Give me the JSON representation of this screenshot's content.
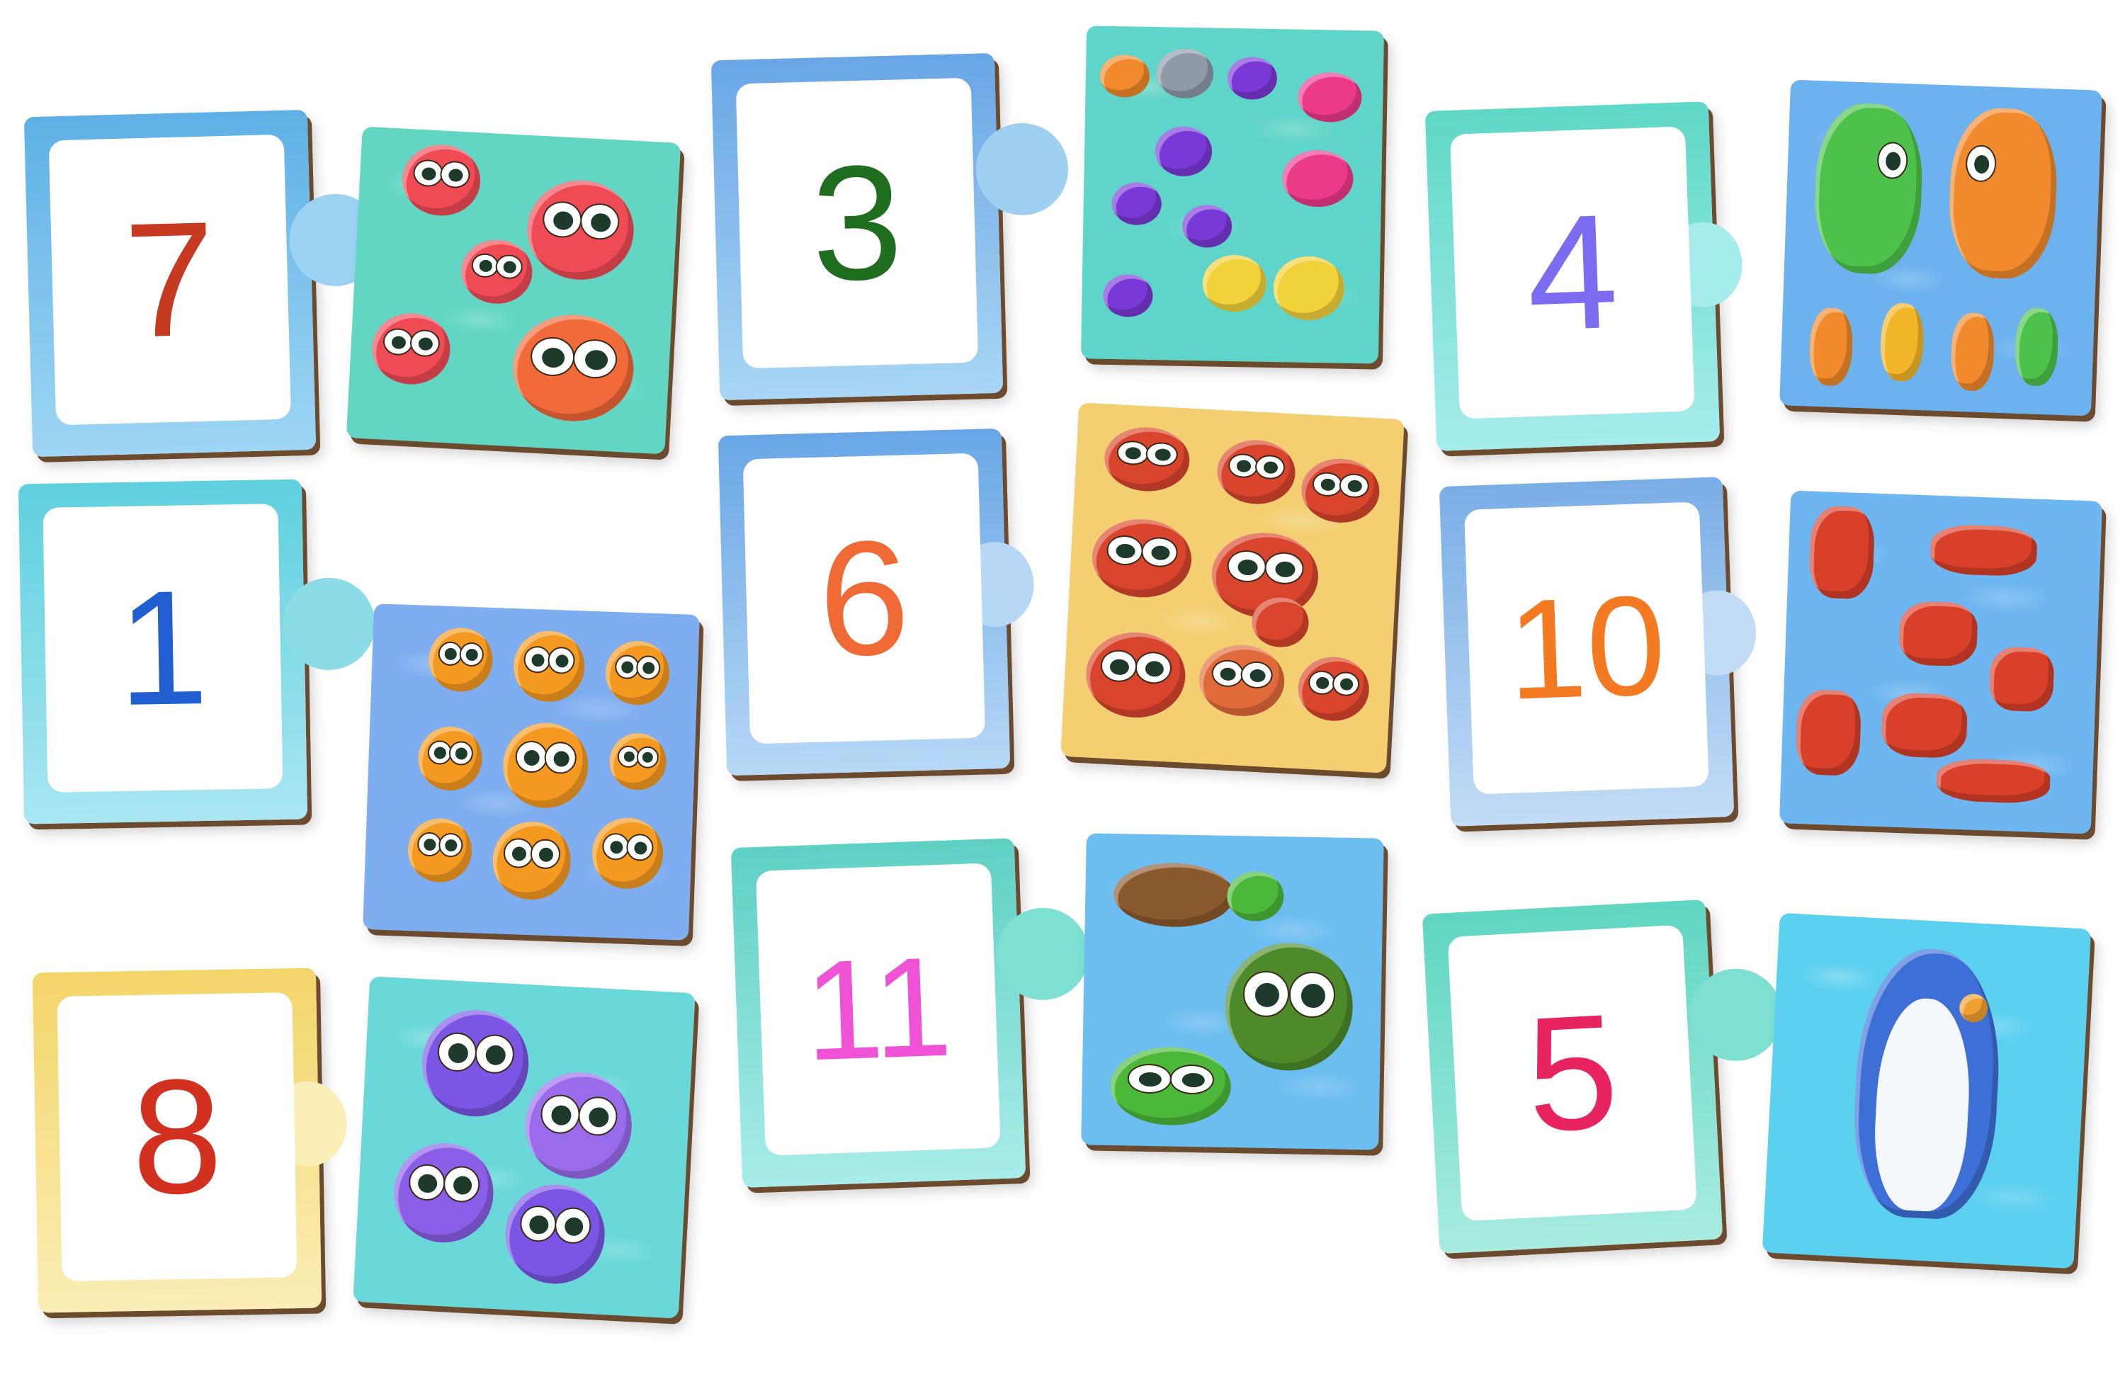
{
  "pairs": [
    {
      "number": "7",
      "digit_color": "#c63a22",
      "frame_color": "#7ec8ec",
      "picture": {
        "animal": "octopus",
        "bg": "#62d6c3",
        "critter_color": "#ef4b55"
      }
    },
    {
      "number": "3",
      "digit_color": "#1f6d1f",
      "frame_color": "#87c2ee",
      "picture": {
        "animal": "fish",
        "bg": "#5fd4c8",
        "critter_color": "#7a39d6"
      }
    },
    {
      "number": "4",
      "digit_color": "#7c6df0",
      "frame_color": "#7ee3da",
      "picture": {
        "animal": "seahorse",
        "bg": "#6cb2ef",
        "critter_color": "#f08a2c"
      }
    },
    {
      "number": "1",
      "digit_color": "#1f5fcf",
      "frame_color": "#6cd8e2",
      "picture": {
        "animal": "pufferfish",
        "bg": "#7eaef0",
        "critter_color": "#f49a20"
      }
    },
    {
      "number": "6",
      "digit_color": "#ef6a34",
      "frame_color": "#86b9ea",
      "picture": {
        "animal": "crab",
        "bg": "#f3cf72",
        "critter_color": "#d8452c"
      }
    },
    {
      "number": "10",
      "digit_color": "#f47a22",
      "frame_color": "#8fbcf0",
      "picture": {
        "animal": "shrimp",
        "bg": "#6eb6f0",
        "critter_color": "#d8402a"
      }
    },
    {
      "number": "8",
      "digit_color": "#d2311f",
      "frame_color": "#f7e08a",
      "picture": {
        "animal": "jellyfish",
        "bg": "#6ad7d8",
        "critter_color": "#7b56e4"
      }
    },
    {
      "number": "11",
      "digit_color": "#f052d6",
      "frame_color": "#71dcd0",
      "picture": {
        "animal": "turtle",
        "bg": "#6cbdf0",
        "critter_color": "#4cb83a"
      }
    },
    {
      "number": "5",
      "digit_color": "#e8245e",
      "frame_color": "#7ce0cf",
      "picture": {
        "animal": "shark",
        "bg": "#5cd0ef",
        "critter_color": "#3d6fd6"
      }
    }
  ]
}
